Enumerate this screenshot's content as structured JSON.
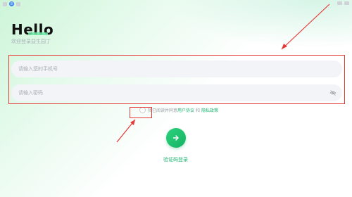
{
  "status": {
    "badge": "8"
  },
  "header": {
    "title": "Hello",
    "subtitle": "欢迎登录益生园丁"
  },
  "form": {
    "phone_placeholder": "请输入您的手机号",
    "password_placeholder": "请输入密码"
  },
  "agreement": {
    "prefix": "我已阅读并同意",
    "user_agreement": "用户协议",
    "joiner": "和",
    "privacy_policy": "隐私政策"
  },
  "actions": {
    "code_login_label": "验证码登录"
  },
  "colors": {
    "accent": "#22b573",
    "annotation": "#e53935"
  },
  "icons": {
    "login": "arrow-right-icon",
    "visibility": "eye-off-icon"
  }
}
